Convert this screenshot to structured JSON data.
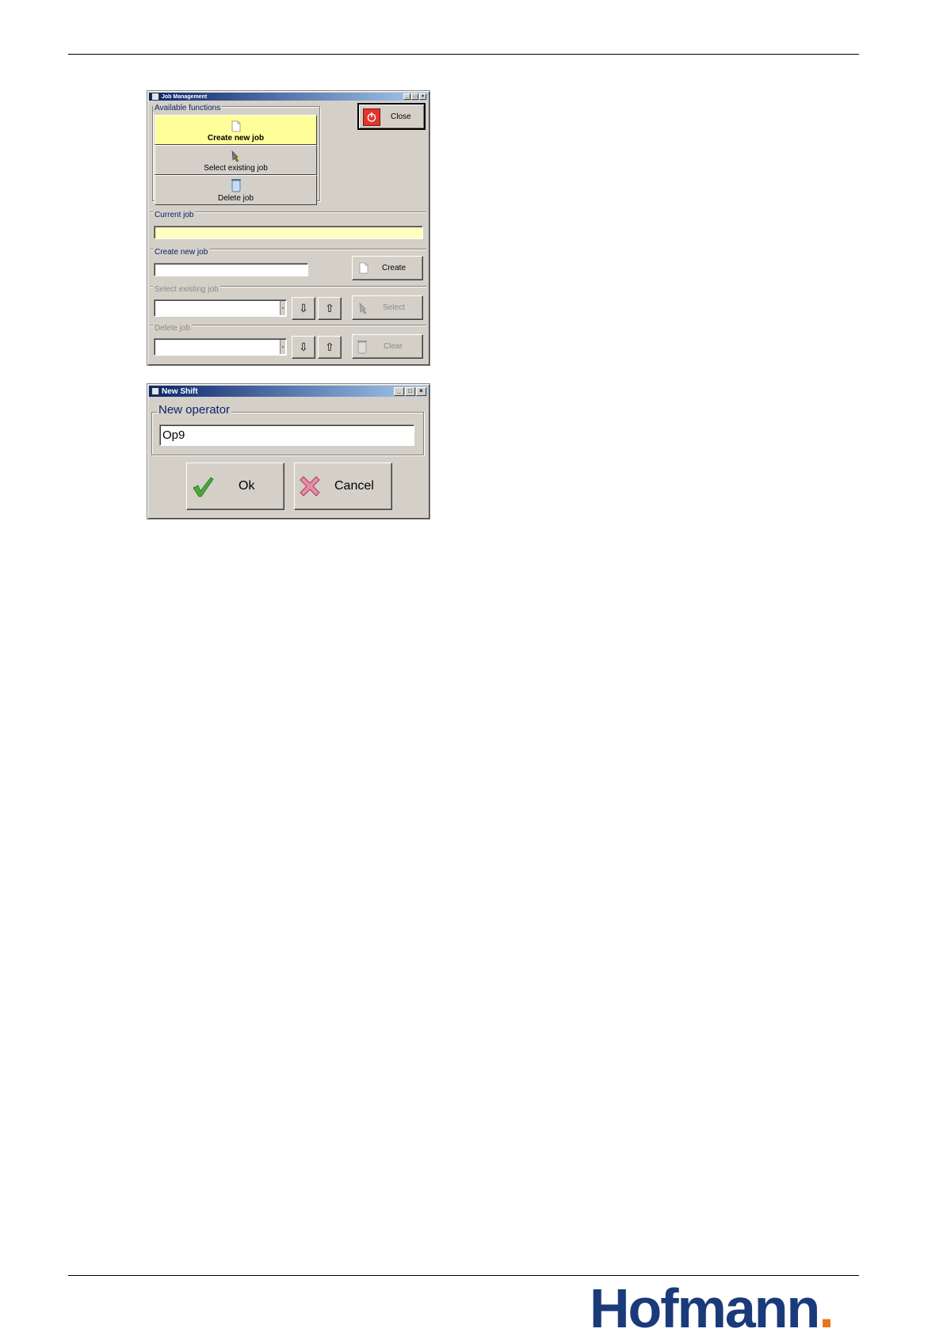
{
  "job_window": {
    "title": "Job Management",
    "available_functions_label": "Available functions",
    "functions": [
      {
        "label": "Create new job"
      },
      {
        "label": "Select existing job"
      },
      {
        "label": "Delete job"
      }
    ],
    "close_label": "Close",
    "current_job_label": "Current job",
    "current_job_value": "",
    "create_new_job_label": "Create new job",
    "create_new_job_value": "",
    "create_label": "Create",
    "select_existing_job_label": "Select existing job",
    "select_label": "Select",
    "delete_job_label": "Delete job",
    "clear_label": "Clear"
  },
  "shift_window": {
    "title": "New Shift",
    "new_operator_label": "New operator",
    "operator_value": "Op9",
    "ok_label": "Ok",
    "cancel_label": "Cancel"
  },
  "footer": {
    "brand_text": "Hofmann",
    "brand_dot": ".",
    "brand_color": "#1a3a7a",
    "dot_color": "#e8731b"
  },
  "colors": {
    "dialog_bg": "#d4d0c8",
    "highlight_yellow": "#ffff99",
    "label_blue": "#0a246a",
    "close_red": "#e0362c"
  }
}
